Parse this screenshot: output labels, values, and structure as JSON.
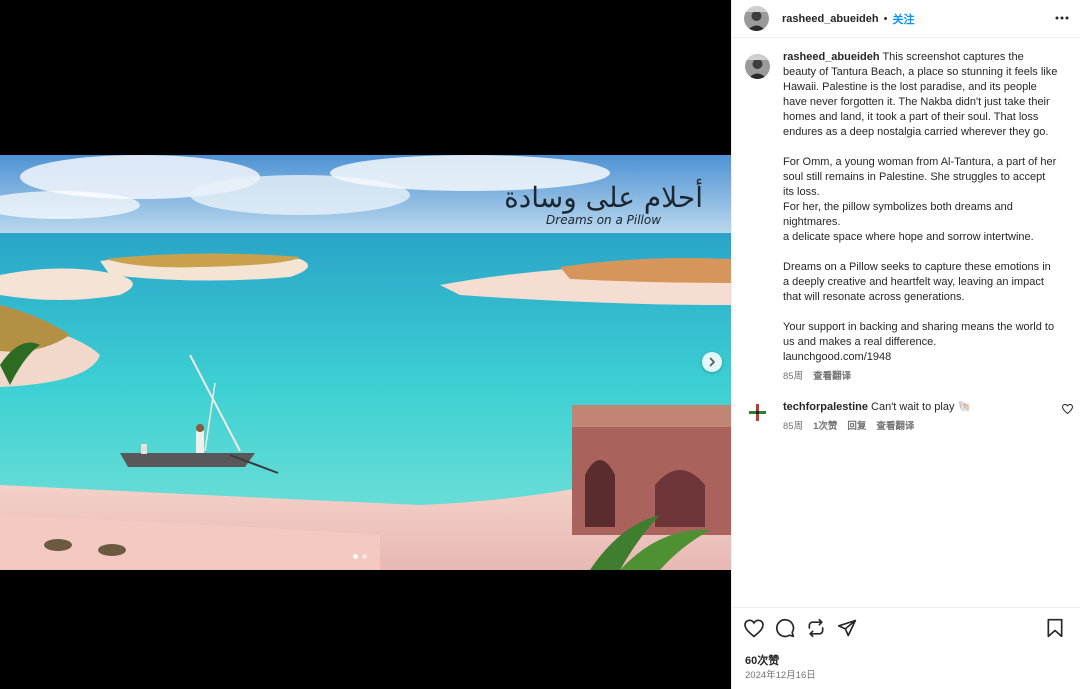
{
  "post": {
    "author": "rasheed_abueideh",
    "separator": "•",
    "follow_label": "关注",
    "more_icon": "more-horizontal-icon"
  },
  "media": {
    "artwork_title_script": "أحلام على وسادة",
    "artwork_title_latin": "Dreams on a Pillow",
    "next_icon": "chevron-right-icon",
    "slides": 2,
    "active_slide": 1
  },
  "caption": {
    "username": "rasheed_abueideh",
    "paragraphs": [
      "This screenshot captures the beauty of Tantura Beach, a place so stunning it feels like Hawaii. Palestine is the lost paradise, and its people have never forgotten it. The Nakba didn't just take their homes and land, it took a part of their soul. That loss endures as a deep nostalgia carried wherever they go.",
      "For Omm, a young woman from Al-Tantura, a part of her soul still remains in Palestine. She struggles to accept its loss.\nFor her, the pillow symbolizes both dreams and nightmares.\na delicate space where hope and sorrow intertwine.",
      "Dreams on a Pillow seeks to capture these emotions in a deeply creative and heartfelt way, leaving an impact that will resonate across generations.",
      "Your support in backing and sharing means the world to us and makes a real difference.\nlaunchgood.com/1948"
    ],
    "time": "85周",
    "translate_label": "查看翻译"
  },
  "comment": {
    "username": "techforpalestine",
    "text": "Can't wait to play 🐚",
    "time": "85周",
    "likes": "1次赞",
    "reply_label": "回复",
    "translate_label": "查看翻译"
  },
  "actions": {
    "like_icon": "heart-icon",
    "comment_icon": "comment-icon",
    "repost_icon": "repost-icon",
    "share_icon": "send-icon",
    "save_icon": "bookmark-icon",
    "likes_count": "60次赞",
    "date": "2024年12月16日"
  }
}
